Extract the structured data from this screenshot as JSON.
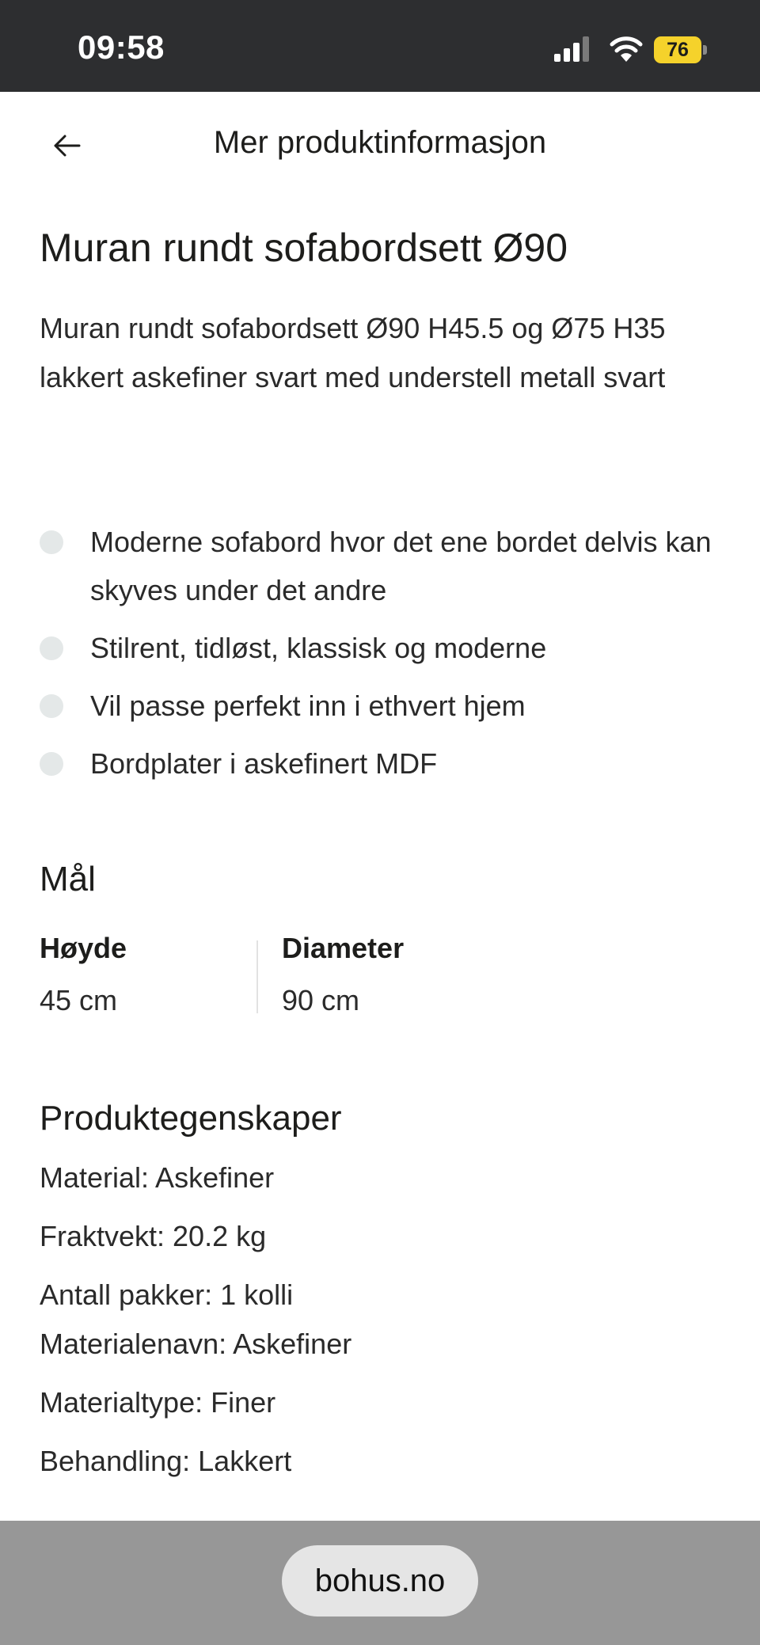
{
  "status_bar": {
    "time": "09:58",
    "battery": "76",
    "icons": [
      "signal-icon",
      "wifi-icon",
      "battery-icon"
    ]
  },
  "header": {
    "back_icon": "arrow-left-icon",
    "title": "Mer produktinformasjon"
  },
  "product": {
    "title": "Muran rundt sofabordsett Ø90",
    "description": "Muran rundt sofabordsett Ø90 H45.5 og Ø75 H35 lakkert askefiner svart med understell metall svart",
    "features": [
      "Moderne sofabord hvor det ene bordet delvis kan skyves under det andre",
      "Stilrent, tidløst, klassisk og moderne",
      "Vil passe perfekt inn i ethvert hjem",
      "Bordplater i askefinert MDF"
    ]
  },
  "dimensions": {
    "heading": "Mål",
    "items": [
      {
        "label": "Høyde",
        "value": "45 cm"
      },
      {
        "label": "Diameter",
        "value": "90 cm"
      }
    ]
  },
  "properties": {
    "heading": "Produktegenskaper",
    "items": [
      "Material: Askefiner",
      "Fraktvekt: 20.2 kg",
      "Antall pakker: 1 kolli",
      "Materialenavn: Askefiner",
      "Materialtype: Finer",
      "Behandling: Lakkert"
    ]
  },
  "browser": {
    "url": "bohus.no"
  },
  "colors": {
    "status_bar_bg": "#2d2e30",
    "battery": "#f5d22b",
    "bullet": "#e4e8e8",
    "browser_bar": "#979797"
  }
}
